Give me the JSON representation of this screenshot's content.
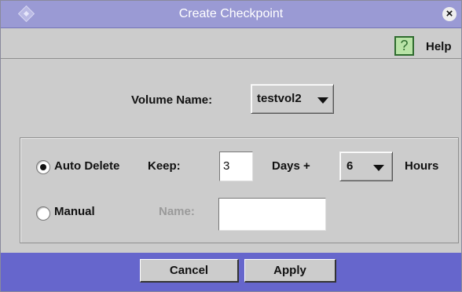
{
  "window": {
    "title": "Create Checkpoint",
    "close_glyph": "×"
  },
  "help": {
    "icon_glyph": "?",
    "label": "Help"
  },
  "volume": {
    "label": "Volume Name:",
    "value": "testvol2"
  },
  "auto_delete": {
    "label": "Auto Delete",
    "selected": true,
    "keep_label": "Keep:",
    "days_value": "3",
    "days_label": "Days +",
    "hours_value": "6",
    "hours_label": "Hours"
  },
  "manual": {
    "label": "Manual",
    "selected": false,
    "name_label": "Name:",
    "name_value": ""
  },
  "buttons": {
    "cancel": "Cancel",
    "apply": "Apply"
  },
  "colors": {
    "titlebar": "#9a9ad4",
    "bottombar": "#6666cc",
    "panel": "#cccccc",
    "help_icon": "#b9e3a7"
  },
  "icons": {
    "window": "diamond-icon",
    "close": "close-icon",
    "help": "help-icon"
  }
}
